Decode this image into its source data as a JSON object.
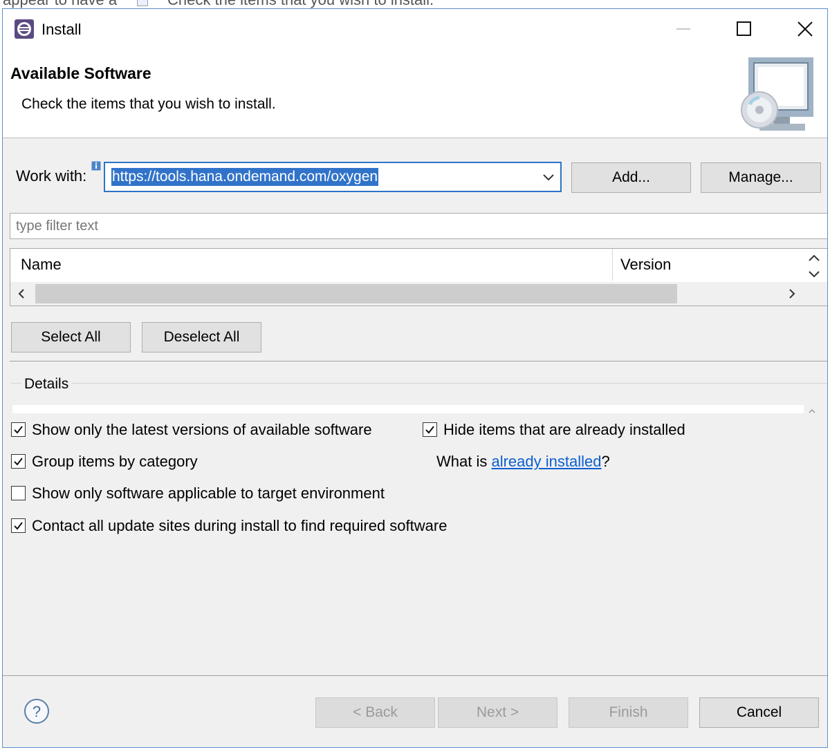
{
  "background_fragments": {
    "left_text": "appear to have a",
    "right_text": "Check the items that you wish to install."
  },
  "window": {
    "title": "Install",
    "controls": [
      "minimize-icon",
      "maximize-icon",
      "close-icon"
    ]
  },
  "header": {
    "title": "Available Software",
    "subtitle": "Check the items that you wish to install.",
    "banner_icon": "install-software-banner-icon"
  },
  "work_with": {
    "label": "Work with:",
    "value": "https://tools.hana.ondemand.com/oxygen",
    "add_label": "Add...",
    "manage_label": "Manage..."
  },
  "filter": {
    "placeholder": "type filter text",
    "value": ""
  },
  "table": {
    "columns": [
      "Name",
      "Version"
    ],
    "rows": []
  },
  "selection": {
    "select_all": "Select All",
    "deselect_all": "Deselect All"
  },
  "details": {
    "label": "Details",
    "text": ""
  },
  "options": {
    "show_latest": {
      "label": "Show only the latest versions of available software",
      "checked": true
    },
    "hide_installed": {
      "label": "Hide items that are already installed",
      "checked": true
    },
    "group_by_category": {
      "label": "Group items by category",
      "checked": true
    },
    "what_is_prefix": "What is ",
    "already_installed_link": "already installed",
    "what_is_suffix": "?",
    "target_env": {
      "label": "Show only software applicable to target environment",
      "checked": false
    },
    "contact_sites": {
      "label": "Contact all update sites during install to find required software",
      "checked": true
    }
  },
  "footer": {
    "back": "< Back",
    "next": "Next >",
    "finish": "Finish",
    "cancel": "Cancel",
    "disabled": [
      "back",
      "next",
      "finish"
    ]
  },
  "colors": {
    "accent": "#2b73c8",
    "selection": "#3173c9",
    "link": "#0b5ed1",
    "dialog_bg": "#f0f0f0"
  }
}
